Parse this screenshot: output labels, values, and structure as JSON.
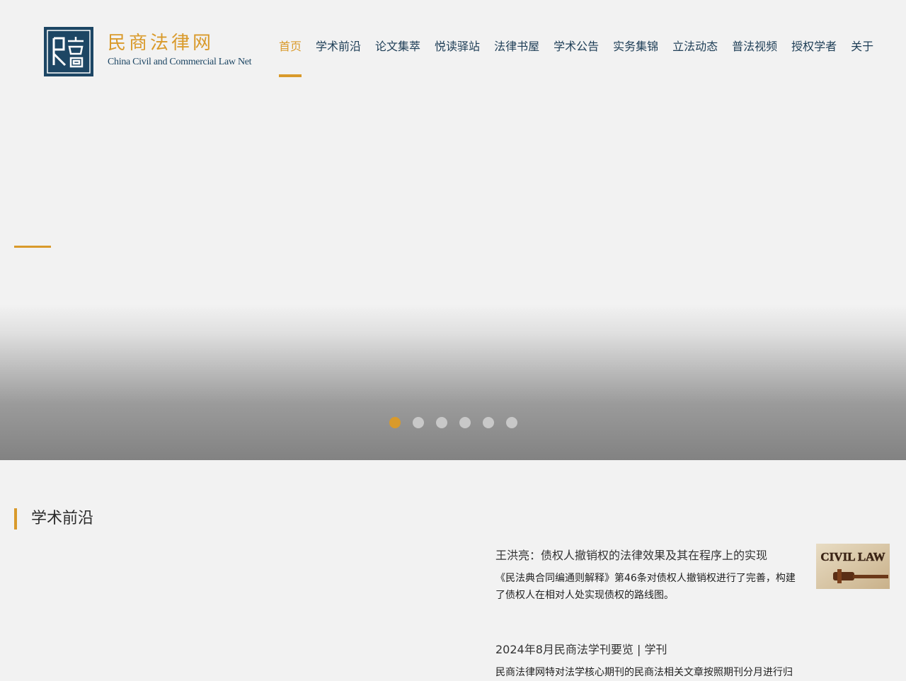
{
  "brand": {
    "name_cn": "民商法律网",
    "name_en": "China Civil and Commercial Law Net",
    "accent_color": "#d99a2b",
    "primary_color": "#1d4664"
  },
  "nav": {
    "items": [
      {
        "label": "首页",
        "active": true
      },
      {
        "label": "学术前沿"
      },
      {
        "label": "论文集萃"
      },
      {
        "label": "悦读驿站"
      },
      {
        "label": "法律书屋"
      },
      {
        "label": "学术公告"
      },
      {
        "label": "实务集锦"
      },
      {
        "label": "立法动态"
      },
      {
        "label": "普法视频"
      },
      {
        "label": "授权学者"
      },
      {
        "label": "关于"
      }
    ]
  },
  "search": {
    "icon": "search-icon"
  },
  "carousel": {
    "slide_count": 6,
    "active_index": 0
  },
  "section": {
    "title": "学术前沿",
    "articles": [
      {
        "title": "王洪亮：债权人撤销权的法律效果及其在程序上的实现",
        "summary": "《民法典合同编通则解释》第46条对债权人撤销权进行了完善，构建了债权人在相对人处实现债权的路线图。",
        "thumb_text": "CIVIL LAW"
      },
      {
        "title": "2024年8月民商法学刊要览 | 学刊",
        "summary": "民商法律网特对法学核心期刊的民商法相关文章按照期刊分月进行归"
      }
    ]
  }
}
